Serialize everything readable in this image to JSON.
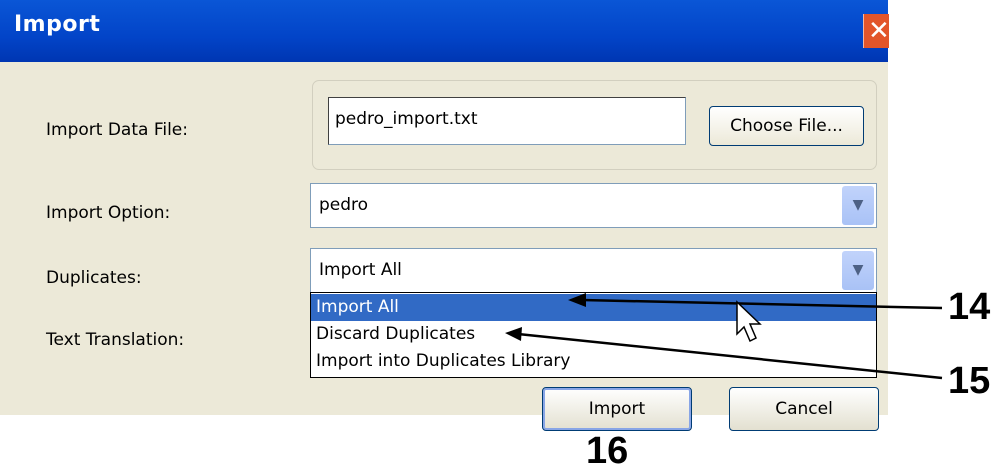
{
  "dialog": {
    "title": "Import",
    "close_glyph": "✕"
  },
  "form": {
    "import_data_file": {
      "label": "Import Data File:",
      "value": "pedro_import.txt",
      "choose_button": "Choose File..."
    },
    "import_option": {
      "label": "Import Option:",
      "value": "pedro"
    },
    "duplicates": {
      "label": "Duplicates:",
      "value": "Import All",
      "options": [
        "Import All",
        "Discard Duplicates",
        "Import into Duplicates Library"
      ],
      "highlighted_index": 0
    },
    "text_translation": {
      "label": "Text Translation:"
    }
  },
  "buttons": {
    "import": "Import",
    "cancel": "Cancel"
  },
  "callouts": {
    "c14": "14",
    "c15": "15",
    "c16": "16"
  },
  "icons": {
    "dropdown_arrow": "chevron-down-icon",
    "cursor": "mouse-pointer-icon"
  },
  "colors": {
    "titlebar": "#0244c8",
    "selection": "#316ac5",
    "dialog_bg": "#ece9d8",
    "close_button": "#e2552a"
  }
}
